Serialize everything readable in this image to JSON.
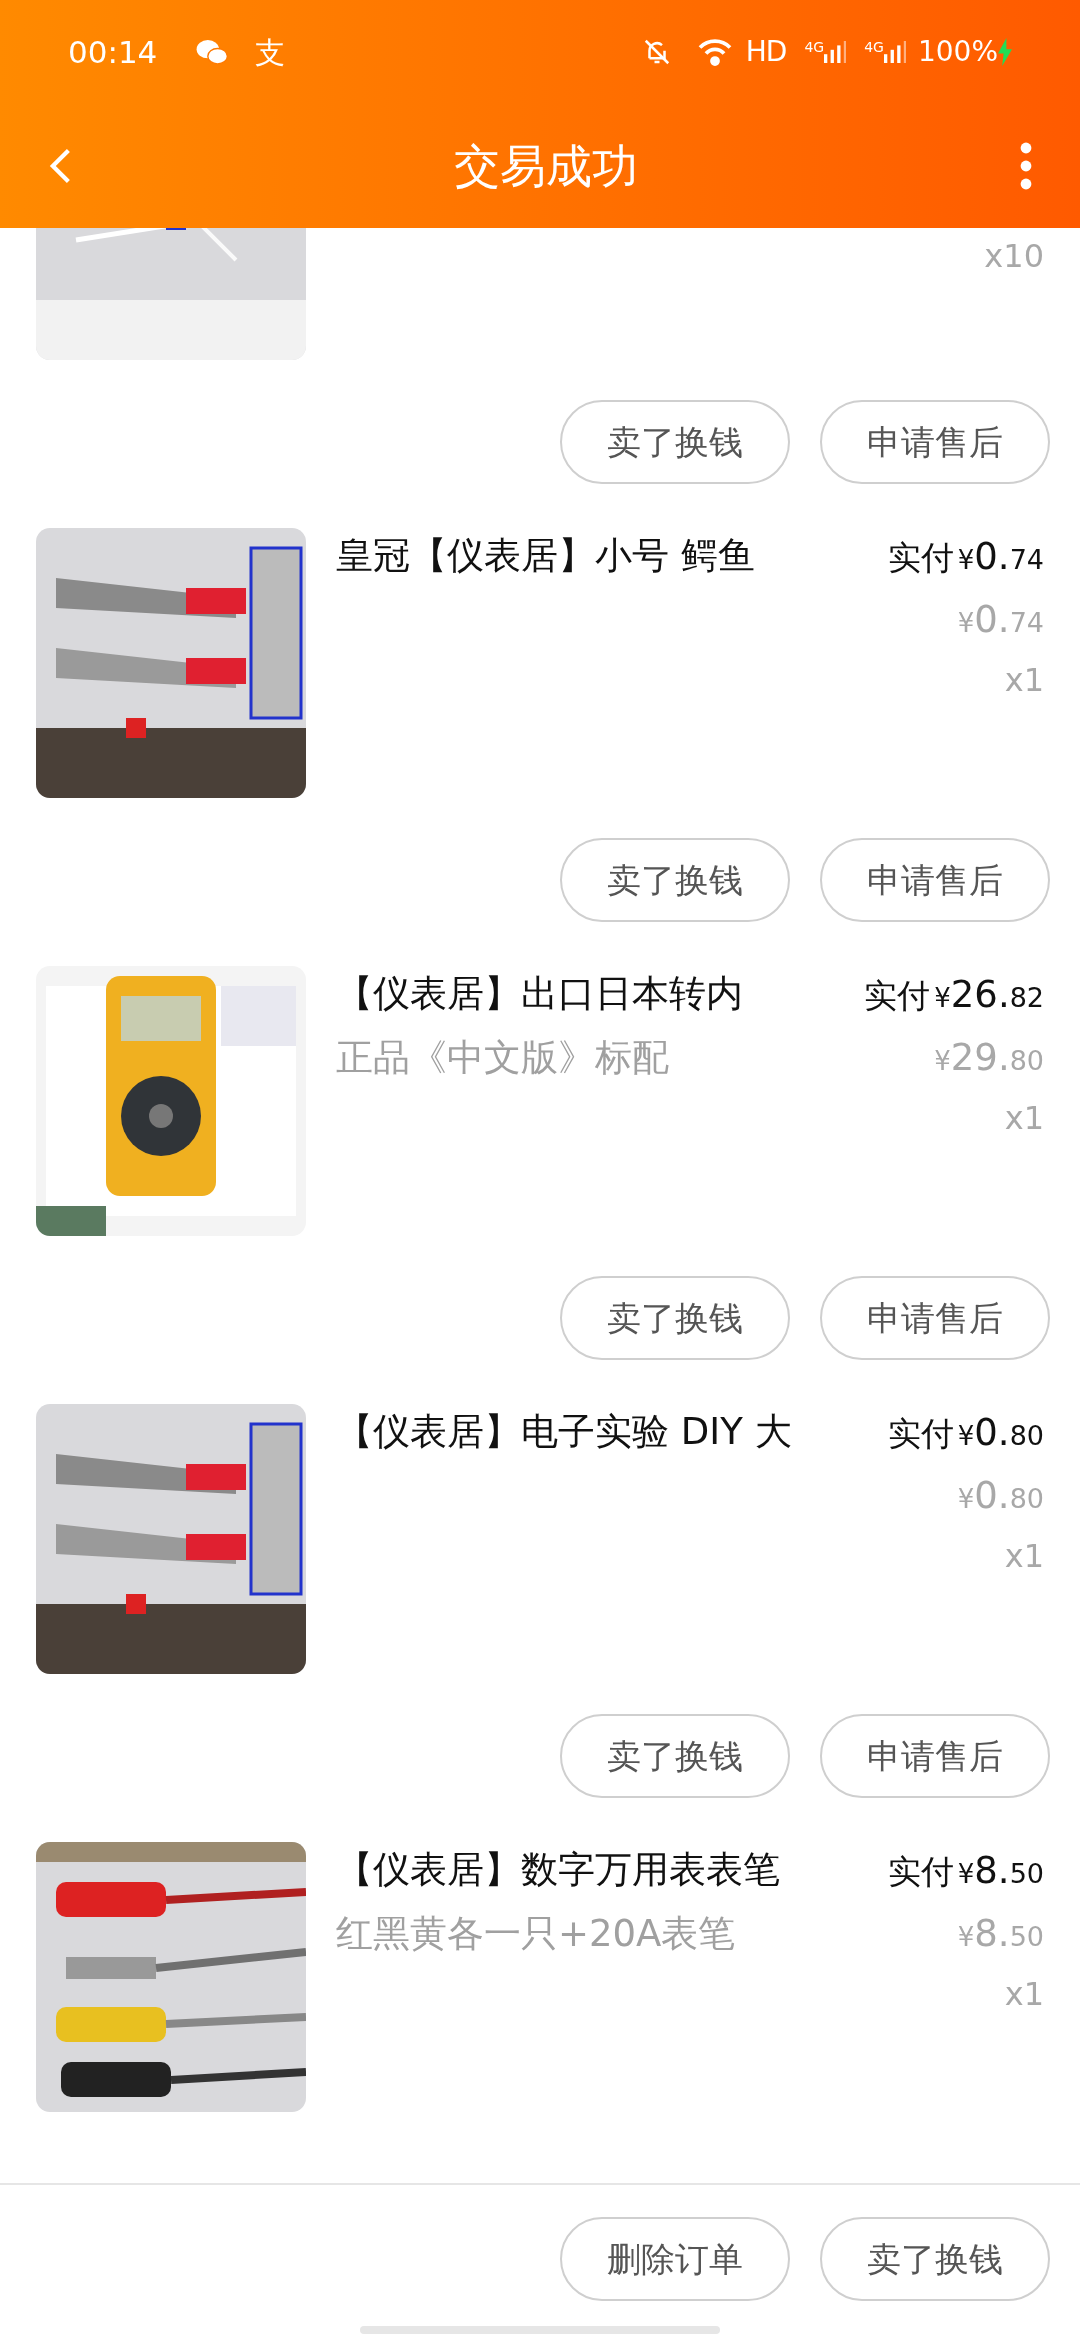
{
  "status_bar": {
    "time": "00:14",
    "app_glyph": "支",
    "hd": "HD",
    "sim_labels": [
      "4G",
      "4G"
    ],
    "battery": "100%",
    "charging": true
  },
  "header": {
    "title": "交易成功"
  },
  "items": [
    {
      "kind": "partial",
      "quantity": "x10",
      "actions": [
        "卖了换钱",
        "申请售后"
      ]
    },
    {
      "kind": "full",
      "title": "皇冠【仪表居】小号 鳄鱼",
      "paid_label": "实付",
      "paid_int": "0.",
      "paid_dec": "74",
      "orig_int": "0.",
      "orig_dec": "74",
      "quantity": "x1",
      "actions": [
        "卖了换钱",
        "申请售后"
      ]
    },
    {
      "kind": "full",
      "title": "【仪表居】出口日本转内",
      "subtitle": "正品《中文版》标配",
      "paid_label": "实付",
      "paid_int": "26.",
      "paid_dec": "82",
      "orig_int": "29.",
      "orig_dec": "80",
      "quantity": "x1",
      "actions": [
        "卖了换钱",
        "申请售后"
      ]
    },
    {
      "kind": "full",
      "title": "【仪表居】电子实验 DIY 大",
      "paid_label": "实付",
      "paid_int": "0.",
      "paid_dec": "80",
      "orig_int": "0.",
      "orig_dec": "80",
      "quantity": "x1",
      "actions": [
        "卖了换钱",
        "申请售后"
      ]
    },
    {
      "kind": "full",
      "title": "【仪表居】数字万用表表笔",
      "subtitle": "红黑黄各一只+20A表笔",
      "paid_label": "实付",
      "paid_int": "8.",
      "paid_dec": "50",
      "orig_int": "8.",
      "orig_dec": "50",
      "quantity": "x1"
    }
  ],
  "currency": "¥",
  "footer": {
    "buttons": [
      "删除订单",
      "卖了换钱"
    ]
  }
}
